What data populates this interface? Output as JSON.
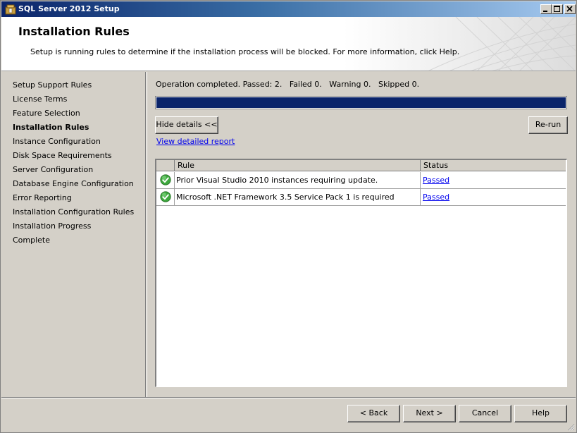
{
  "window": {
    "title": "SQL Server 2012 Setup",
    "app_icon": "sql-server-setup-icon",
    "controls": [
      "minimize-icon",
      "maximize-icon",
      "close-icon"
    ]
  },
  "header": {
    "heading": "Installation Rules",
    "subtext": "Setup is running rules to determine if the installation process will be blocked. For more information, click Help."
  },
  "sidebar": {
    "items": [
      {
        "label": "Setup Support Rules",
        "active": false
      },
      {
        "label": "License Terms",
        "active": false
      },
      {
        "label": "Feature Selection",
        "active": false
      },
      {
        "label": "Installation Rules",
        "active": true
      },
      {
        "label": "Instance Configuration",
        "active": false
      },
      {
        "label": "Disk Space Requirements",
        "active": false
      },
      {
        "label": "Server Configuration",
        "active": false
      },
      {
        "label": "Database Engine Configuration",
        "active": false
      },
      {
        "label": "Error Reporting",
        "active": false
      },
      {
        "label": "Installation Configuration Rules",
        "active": false
      },
      {
        "label": "Installation Progress",
        "active": false
      },
      {
        "label": "Complete",
        "active": false
      }
    ]
  },
  "main": {
    "status_line": "Operation completed. Passed: 2.   Failed 0.   Warning 0.   Skipped 0.",
    "progress": 1.0,
    "progress_color": "#0a246a",
    "hide_details_label": "Hide details <<",
    "rerun_label": "Re-run",
    "view_report_label": "View detailed report",
    "table": {
      "columns": [
        "",
        "Rule",
        "Status"
      ],
      "rows": [
        {
          "icon": "green-check-icon",
          "rule": "Prior Visual Studio 2010 instances requiring update.",
          "status": "Passed"
        },
        {
          "icon": "green-check-icon",
          "rule": "Microsoft .NET Framework 3.5 Service Pack 1 is required",
          "status": "Passed"
        }
      ]
    }
  },
  "footer": {
    "back_label": "< Back",
    "next_label": "Next >",
    "cancel_label": "Cancel",
    "help_label": "Help"
  },
  "colors": {
    "titlebar_start": "#0a246a",
    "titlebar_end": "#a6caf0",
    "link": "#0000ee",
    "pass_green": "#3ea83e"
  }
}
